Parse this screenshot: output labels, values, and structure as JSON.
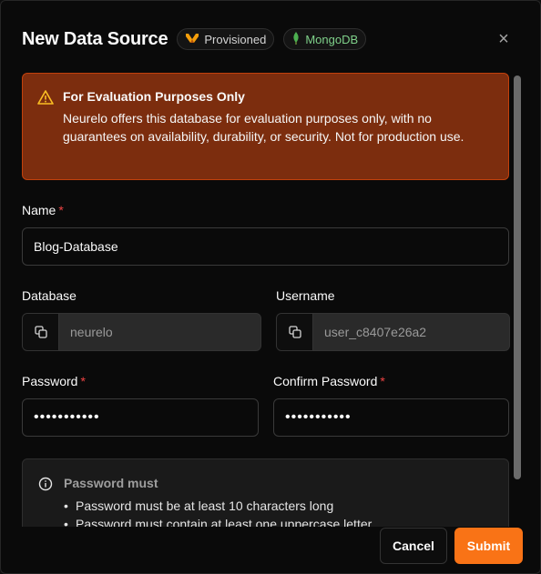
{
  "dialog": {
    "title": "New Data Source",
    "badges": {
      "provisioned": "Provisioned",
      "mongodb": "MongoDB"
    },
    "close_icon": "×"
  },
  "warning": {
    "title": "For Evaluation Purposes Only",
    "text": "Neurelo offers this database for evaluation purposes only, with no guarantees on availability, durability, or security. Not for production use."
  },
  "form": {
    "name": {
      "label": "Name",
      "required": "*",
      "value": "Blog-Database"
    },
    "database": {
      "label": "Database",
      "value": "neurelo"
    },
    "username": {
      "label": "Username",
      "value": "user_c8407e26a2"
    },
    "password": {
      "label": "Password",
      "required": "*",
      "value": "•••••••••••"
    },
    "confirm_password": {
      "label": "Confirm Password",
      "required": "*",
      "value": "•••••••••••"
    }
  },
  "password_rules": {
    "title": "Password must",
    "items": [
      "Password must be at least 10 characters long",
      "Password must contain at least one uppercase letter"
    ]
  },
  "actions": {
    "cancel": "Cancel",
    "submit": "Submit"
  },
  "colors": {
    "accent": "#f97316",
    "warning_bg": "#7c2d0e",
    "warning_border": "#c2410c",
    "required": "#ef4444",
    "mongodb_green": "#4caf50"
  }
}
